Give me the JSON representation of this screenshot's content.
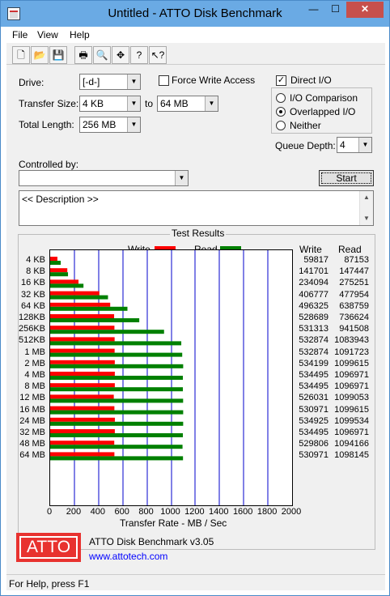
{
  "window": {
    "title": "Untitled - ATTO Disk Benchmark",
    "min_label": "—",
    "max_label": "☐",
    "close_label": "✕"
  },
  "menu": {
    "file": "File",
    "view": "View",
    "help": "Help"
  },
  "toolbar": {
    "buttons": [
      {
        "icon": "new-file-icon",
        "glyph": "🗋"
      },
      {
        "icon": "open-folder-icon",
        "glyph": "📂"
      },
      {
        "icon": "save-icon",
        "glyph": "💾"
      },
      {
        "icon": "print-icon",
        "glyph": "🖶"
      },
      {
        "icon": "print-preview-icon",
        "glyph": "🔍"
      },
      {
        "icon": "move-icon",
        "glyph": "✥"
      },
      {
        "icon": "help-icon",
        "glyph": "?"
      },
      {
        "icon": "context-help-icon",
        "glyph": "↖?"
      }
    ]
  },
  "settings": {
    "drive_label": "Drive:",
    "drive_value": "[-d-]",
    "force_write_label": "Force Write Access",
    "direct_io_label": "Direct I/O",
    "direct_io_checked": true,
    "transfer_size_label": "Transfer Size:",
    "transfer_from": "4 KB",
    "to_label": "to",
    "transfer_to": "64 MB",
    "total_length_label": "Total Length:",
    "total_length_value": "256 MB",
    "io_comparison_label": "I/O Comparison",
    "overlapped_io_label": "Overlapped I/O",
    "neither_label": "Neither",
    "queue_depth_label": "Queue Depth:",
    "queue_depth_value": "4",
    "controlled_by_label": "Controlled by:",
    "controlled_by_value": "",
    "start_label": "Start",
    "description_text": "<< Description >>"
  },
  "results": {
    "title": "Test Results",
    "legend_write": "Write",
    "legend_read": "Read",
    "col_write": "Write",
    "col_read": "Read",
    "rows": [
      {
        "size": "4 KB",
        "write": "59817",
        "read": "87153"
      },
      {
        "size": "8 KB",
        "write": "141701",
        "read": "147447"
      },
      {
        "size": "16 KB",
        "write": "234094",
        "read": "275251"
      },
      {
        "size": "32 KB",
        "write": "406777",
        "read": "477954"
      },
      {
        "size": "64 KB",
        "write": "496325",
        "read": "638759"
      },
      {
        "size": "128KB",
        "write": "528689",
        "read": "736624"
      },
      {
        "size": "256KB",
        "write": "531313",
        "read": "941508"
      },
      {
        "size": "512KB",
        "write": "532874",
        "read": "1083943"
      },
      {
        "size": "1 MB",
        "write": "532874",
        "read": "1091723"
      },
      {
        "size": "2 MB",
        "write": "534199",
        "read": "1099615"
      },
      {
        "size": "4 MB",
        "write": "534495",
        "read": "1096971"
      },
      {
        "size": "8 MB",
        "write": "534495",
        "read": "1096971"
      },
      {
        "size": "12 MB",
        "write": "526031",
        "read": "1099053"
      },
      {
        "size": "16 MB",
        "write": "530971",
        "read": "1099615"
      },
      {
        "size": "24 MB",
        "write": "534925",
        "read": "1099534"
      },
      {
        "size": "32 MB",
        "write": "534495",
        "read": "1096971"
      },
      {
        "size": "48 MB",
        "write": "529806",
        "read": "1094166"
      },
      {
        "size": "64 MB",
        "write": "530971",
        "read": "1098145"
      }
    ],
    "x_ticks": [
      "0",
      "200",
      "400",
      "600",
      "800",
      "1000",
      "1200",
      "1400",
      "1600",
      "1800",
      "2000"
    ],
    "x_label": "Transfer Rate - MB / Sec",
    "colors": {
      "write": "#ff0000",
      "read": "#008000",
      "grid": "#0000cc"
    }
  },
  "chart_data": {
    "type": "bar",
    "categories": [
      "4 KB",
      "8 KB",
      "16 KB",
      "32 KB",
      "64 KB",
      "128KB",
      "256KB",
      "512KB",
      "1 MB",
      "2 MB",
      "4 MB",
      "8 MB",
      "12 MB",
      "16 MB",
      "24 MB",
      "32 MB",
      "48 MB",
      "64 MB"
    ],
    "series": [
      {
        "name": "Write",
        "values": [
          59.8,
          141.7,
          234.1,
          406.8,
          496.3,
          528.7,
          531.3,
          532.9,
          532.9,
          534.2,
          534.5,
          534.5,
          526.0,
          531.0,
          534.9,
          534.5,
          529.8,
          531.0
        ]
      },
      {
        "name": "Read",
        "values": [
          87.2,
          147.4,
          275.3,
          478.0,
          638.8,
          736.6,
          941.5,
          1083.9,
          1091.7,
          1099.6,
          1097.0,
          1097.0,
          1099.1,
          1099.6,
          1099.5,
          1097.0,
          1094.2,
          1098.1
        ]
      }
    ],
    "xlabel": "Transfer Rate - MB / Sec",
    "xlim": [
      0,
      2000
    ]
  },
  "footer": {
    "logo_text": "ATTO",
    "product": "ATTO Disk Benchmark v3.05",
    "url": "www.attotech.com"
  },
  "status": {
    "text": "For Help, press F1"
  }
}
